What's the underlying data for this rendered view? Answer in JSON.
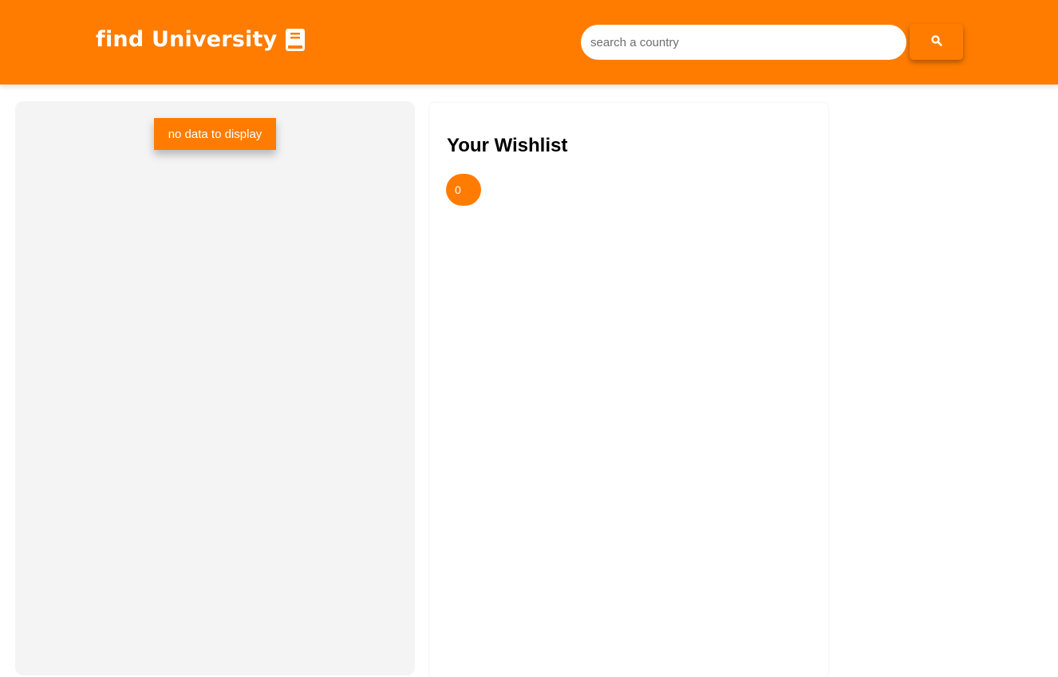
{
  "header": {
    "title": "find University",
    "logo_icon": "book-icon",
    "background_color": "#ff7c00"
  },
  "search": {
    "value": "",
    "placeholder": "search a country",
    "button_icon": "search-icon"
  },
  "results": {
    "empty_label": "no data to display"
  },
  "wishlist": {
    "title": "Your Wishlist",
    "count": "0"
  }
}
